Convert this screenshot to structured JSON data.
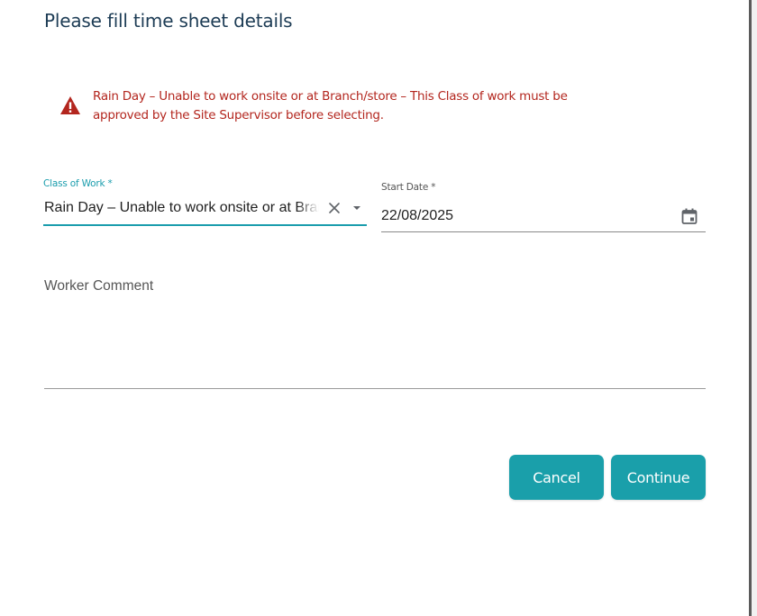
{
  "dialog": {
    "title": "Please fill time sheet details"
  },
  "alert": {
    "icon": "warning-triangle-icon",
    "color": "#b3261e",
    "message_line1": "Rain Day – Unable to work onsite or at Branch/store – This Class of work must be",
    "message_line2": "approved by the Site Supervisor before selecting."
  },
  "form": {
    "class_of_work": {
      "label": "Class of Work *",
      "value": "Rain Day – Unable to work onsite or at Branch/store",
      "clear_icon": "close-icon",
      "dropdown_icon": "caret-down-icon"
    },
    "start_date": {
      "label": "Start Date *",
      "value": "22/08/2025",
      "icon": "calendar-icon"
    },
    "worker_comment": {
      "label": "Worker Comment",
      "value": ""
    }
  },
  "actions": {
    "cancel_label": "Cancel",
    "continue_label": "Continue",
    "button_color": "#1a9faa"
  },
  "colors": {
    "title": "#1d3c55",
    "accent": "#1a9dad"
  }
}
